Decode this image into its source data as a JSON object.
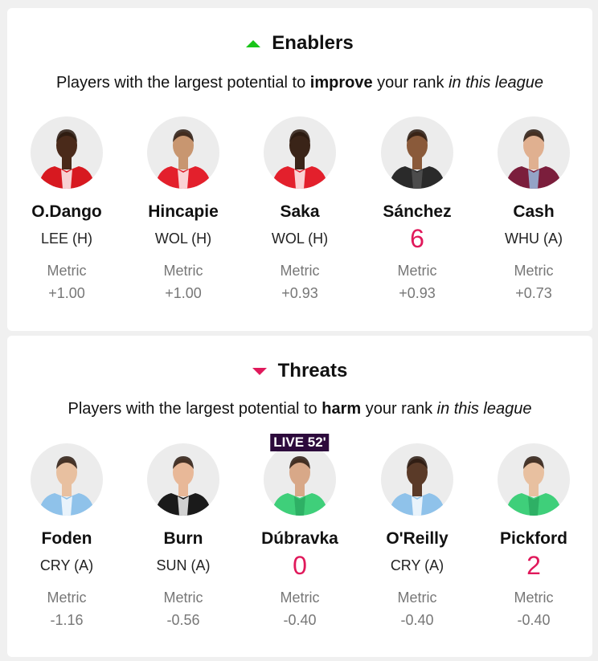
{
  "enablers": {
    "title": "Enablers",
    "subtitle_pre": "Players with the largest potential to ",
    "subtitle_bold": "improve",
    "subtitle_mid": " your rank ",
    "subtitle_italic": "in this league",
    "players": [
      {
        "name": "O.Dango",
        "fixture": "LEE (H)",
        "metric_label": "Metric",
        "metric_value": "+1.00",
        "kit": "#d71920",
        "kit2": "#ffffff",
        "skin": "#4a2a1a"
      },
      {
        "name": "Hincapie",
        "fixture": "WOL (H)",
        "metric_label": "Metric",
        "metric_value": "+1.00",
        "kit": "#e3202c",
        "kit2": "#ffffff",
        "skin": "#c89670"
      },
      {
        "name": "Saka",
        "fixture": "WOL (H)",
        "metric_label": "Metric",
        "metric_value": "+0.93",
        "kit": "#e3202c",
        "kit2": "#ffffff",
        "skin": "#3a2418"
      },
      {
        "name": "Sánchez",
        "fixture": "6",
        "fixture_live": true,
        "metric_label": "Metric",
        "metric_value": "+0.93",
        "kit": "#2a2a2a",
        "kit2": "#555555",
        "skin": "#8a5a3a"
      },
      {
        "name": "Cash",
        "fixture": "WHU (A)",
        "metric_label": "Metric",
        "metric_value": "+0.73",
        "kit": "#7b1e3c",
        "kit2": "#9bc4e8",
        "skin": "#e0b090"
      }
    ]
  },
  "threats": {
    "title": "Threats",
    "subtitle_pre": "Players with the largest potential to ",
    "subtitle_bold": "harm",
    "subtitle_mid": " your rank ",
    "subtitle_italic": "in this league",
    "players": [
      {
        "name": "Foden",
        "fixture": "CRY (A)",
        "metric_label": "Metric",
        "metric_value": "-1.16",
        "kit": "#8fc2ea",
        "kit2": "#ffffff",
        "skin": "#e8c0a0"
      },
      {
        "name": "Burn",
        "fixture": "SUN (A)",
        "metric_label": "Metric",
        "metric_value": "-0.56",
        "kit": "#1a1a1a",
        "kit2": "#ffffff",
        "skin": "#e8b898"
      },
      {
        "name": "Dúbravka",
        "fixture": "0",
        "fixture_live": true,
        "live_badge": "LIVE 52'",
        "metric_label": "Metric",
        "metric_value": "-0.40",
        "kit": "#3fcf7a",
        "kit2": "#2aa860",
        "skin": "#d8a888"
      },
      {
        "name": "O'Reilly",
        "fixture": "CRY (A)",
        "metric_label": "Metric",
        "metric_value": "-0.40",
        "kit": "#8fc2ea",
        "kit2": "#ffffff",
        "skin": "#5a3a28"
      },
      {
        "name": "Pickford",
        "fixture": "2",
        "fixture_live": true,
        "metric_label": "Metric",
        "metric_value": "-0.40",
        "kit": "#3fcf7a",
        "kit2": "#2aa860",
        "skin": "#e8c0a0"
      }
    ]
  },
  "colors": {
    "enablers_arrow": "#19c419",
    "threats_arrow": "#e0195b",
    "live_value": "#e0195b",
    "live_badge_bg": "#2d0a3c"
  },
  "icons": {
    "enablers_icon": "triangle-up-icon",
    "threats_icon": "triangle-down-icon",
    "avatar_icon": "player-avatar-icon"
  }
}
